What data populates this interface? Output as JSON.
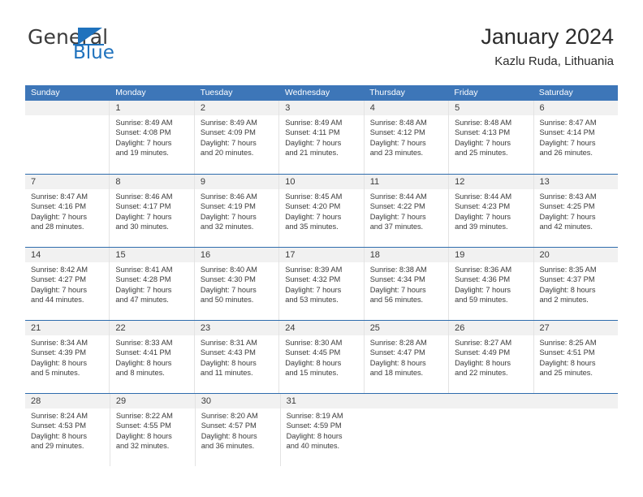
{
  "brand": {
    "name_top": "General",
    "name_bottom": "Blue",
    "accent_color": "#1f72bd"
  },
  "header": {
    "title": "January 2024",
    "subtitle": "Kazlu Ruda, Lithuania"
  },
  "theme": {
    "header_row_bg": "#3d76b8",
    "week_divider": "#2e6cad",
    "daynum_band_bg": "#f1f1f1",
    "text": "#3b3b3b"
  },
  "weekdays": [
    "Sunday",
    "Monday",
    "Tuesday",
    "Wednesday",
    "Thursday",
    "Friday",
    "Saturday"
  ],
  "weeks": [
    [
      {
        "day": "",
        "lines": []
      },
      {
        "day": "1",
        "lines": [
          "Sunrise: 8:49 AM",
          "Sunset: 4:08 PM",
          "Daylight: 7 hours",
          "and 19 minutes."
        ]
      },
      {
        "day": "2",
        "lines": [
          "Sunrise: 8:49 AM",
          "Sunset: 4:09 PM",
          "Daylight: 7 hours",
          "and 20 minutes."
        ]
      },
      {
        "day": "3",
        "lines": [
          "Sunrise: 8:49 AM",
          "Sunset: 4:11 PM",
          "Daylight: 7 hours",
          "and 21 minutes."
        ]
      },
      {
        "day": "4",
        "lines": [
          "Sunrise: 8:48 AM",
          "Sunset: 4:12 PM",
          "Daylight: 7 hours",
          "and 23 minutes."
        ]
      },
      {
        "day": "5",
        "lines": [
          "Sunrise: 8:48 AM",
          "Sunset: 4:13 PM",
          "Daylight: 7 hours",
          "and 25 minutes."
        ]
      },
      {
        "day": "6",
        "lines": [
          "Sunrise: 8:47 AM",
          "Sunset: 4:14 PM",
          "Daylight: 7 hours",
          "and 26 minutes."
        ]
      }
    ],
    [
      {
        "day": "7",
        "lines": [
          "Sunrise: 8:47 AM",
          "Sunset: 4:16 PM",
          "Daylight: 7 hours",
          "and 28 minutes."
        ]
      },
      {
        "day": "8",
        "lines": [
          "Sunrise: 8:46 AM",
          "Sunset: 4:17 PM",
          "Daylight: 7 hours",
          "and 30 minutes."
        ]
      },
      {
        "day": "9",
        "lines": [
          "Sunrise: 8:46 AM",
          "Sunset: 4:19 PM",
          "Daylight: 7 hours",
          "and 32 minutes."
        ]
      },
      {
        "day": "10",
        "lines": [
          "Sunrise: 8:45 AM",
          "Sunset: 4:20 PM",
          "Daylight: 7 hours",
          "and 35 minutes."
        ]
      },
      {
        "day": "11",
        "lines": [
          "Sunrise: 8:44 AM",
          "Sunset: 4:22 PM",
          "Daylight: 7 hours",
          "and 37 minutes."
        ]
      },
      {
        "day": "12",
        "lines": [
          "Sunrise: 8:44 AM",
          "Sunset: 4:23 PM",
          "Daylight: 7 hours",
          "and 39 minutes."
        ]
      },
      {
        "day": "13",
        "lines": [
          "Sunrise: 8:43 AM",
          "Sunset: 4:25 PM",
          "Daylight: 7 hours",
          "and 42 minutes."
        ]
      }
    ],
    [
      {
        "day": "14",
        "lines": [
          "Sunrise: 8:42 AM",
          "Sunset: 4:27 PM",
          "Daylight: 7 hours",
          "and 44 minutes."
        ]
      },
      {
        "day": "15",
        "lines": [
          "Sunrise: 8:41 AM",
          "Sunset: 4:28 PM",
          "Daylight: 7 hours",
          "and 47 minutes."
        ]
      },
      {
        "day": "16",
        "lines": [
          "Sunrise: 8:40 AM",
          "Sunset: 4:30 PM",
          "Daylight: 7 hours",
          "and 50 minutes."
        ]
      },
      {
        "day": "17",
        "lines": [
          "Sunrise: 8:39 AM",
          "Sunset: 4:32 PM",
          "Daylight: 7 hours",
          "and 53 minutes."
        ]
      },
      {
        "day": "18",
        "lines": [
          "Sunrise: 8:38 AM",
          "Sunset: 4:34 PM",
          "Daylight: 7 hours",
          "and 56 minutes."
        ]
      },
      {
        "day": "19",
        "lines": [
          "Sunrise: 8:36 AM",
          "Sunset: 4:36 PM",
          "Daylight: 7 hours",
          "and 59 minutes."
        ]
      },
      {
        "day": "20",
        "lines": [
          "Sunrise: 8:35 AM",
          "Sunset: 4:37 PM",
          "Daylight: 8 hours",
          "and 2 minutes."
        ]
      }
    ],
    [
      {
        "day": "21",
        "lines": [
          "Sunrise: 8:34 AM",
          "Sunset: 4:39 PM",
          "Daylight: 8 hours",
          "and 5 minutes."
        ]
      },
      {
        "day": "22",
        "lines": [
          "Sunrise: 8:33 AM",
          "Sunset: 4:41 PM",
          "Daylight: 8 hours",
          "and 8 minutes."
        ]
      },
      {
        "day": "23",
        "lines": [
          "Sunrise: 8:31 AM",
          "Sunset: 4:43 PM",
          "Daylight: 8 hours",
          "and 11 minutes."
        ]
      },
      {
        "day": "24",
        "lines": [
          "Sunrise: 8:30 AM",
          "Sunset: 4:45 PM",
          "Daylight: 8 hours",
          "and 15 minutes."
        ]
      },
      {
        "day": "25",
        "lines": [
          "Sunrise: 8:28 AM",
          "Sunset: 4:47 PM",
          "Daylight: 8 hours",
          "and 18 minutes."
        ]
      },
      {
        "day": "26",
        "lines": [
          "Sunrise: 8:27 AM",
          "Sunset: 4:49 PM",
          "Daylight: 8 hours",
          "and 22 minutes."
        ]
      },
      {
        "day": "27",
        "lines": [
          "Sunrise: 8:25 AM",
          "Sunset: 4:51 PM",
          "Daylight: 8 hours",
          "and 25 minutes."
        ]
      }
    ],
    [
      {
        "day": "28",
        "lines": [
          "Sunrise: 8:24 AM",
          "Sunset: 4:53 PM",
          "Daylight: 8 hours",
          "and 29 minutes."
        ]
      },
      {
        "day": "29",
        "lines": [
          "Sunrise: 8:22 AM",
          "Sunset: 4:55 PM",
          "Daylight: 8 hours",
          "and 32 minutes."
        ]
      },
      {
        "day": "30",
        "lines": [
          "Sunrise: 8:20 AM",
          "Sunset: 4:57 PM",
          "Daylight: 8 hours",
          "and 36 minutes."
        ]
      },
      {
        "day": "31",
        "lines": [
          "Sunrise: 8:19 AM",
          "Sunset: 4:59 PM",
          "Daylight: 8 hours",
          "and 40 minutes."
        ]
      },
      {
        "day": "",
        "lines": []
      },
      {
        "day": "",
        "lines": []
      },
      {
        "day": "",
        "lines": []
      }
    ]
  ]
}
